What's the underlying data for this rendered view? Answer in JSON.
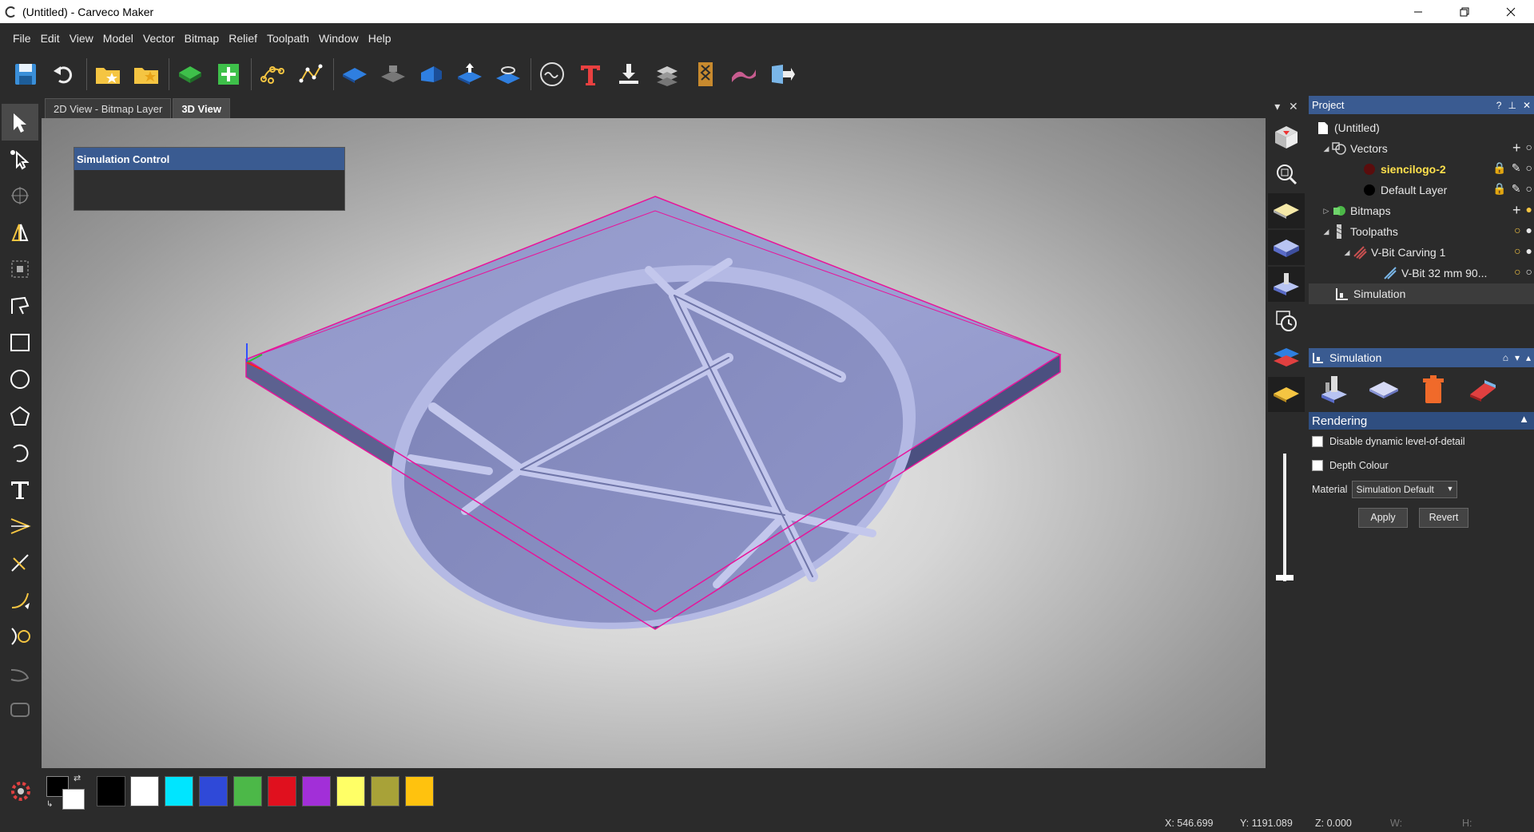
{
  "window": {
    "title": "(Untitled) - Carveco Maker"
  },
  "menu": [
    "File",
    "Edit",
    "View",
    "Model",
    "Vector",
    "Bitmap",
    "Relief",
    "Toolpath",
    "Window",
    "Help"
  ],
  "tabs": [
    {
      "label": "2D View - Bitmap Layer",
      "active": false
    },
    {
      "label": "3D View",
      "active": true
    }
  ],
  "simulation_control": {
    "title": "Simulation Control"
  },
  "project_panel": {
    "title": "Project",
    "tree": [
      {
        "label": "(Untitled)",
        "level": 0,
        "icon": "document-icon"
      },
      {
        "label": "Vectors",
        "level": 1,
        "icon": "vectors-icon",
        "expanded": true
      },
      {
        "label": "siencilogo-2",
        "level": 2,
        "icon": "layer-dark-red-icon",
        "highlight": true
      },
      {
        "label": "Default Layer",
        "level": 2,
        "icon": "layer-black-icon"
      },
      {
        "label": "Bitmaps",
        "level": 1,
        "icon": "bitmaps-icon",
        "expanded": false
      },
      {
        "label": "Toolpaths",
        "level": 1,
        "icon": "toolpaths-icon",
        "expanded": true
      },
      {
        "label": "V-Bit Carving 1",
        "level": 2,
        "icon": "vbit-carving-icon",
        "expanded": true
      },
      {
        "label": "V-Bit 32 mm 90...",
        "level": 3,
        "icon": "vbit-tool-icon"
      },
      {
        "label": "Simulation",
        "level": 1,
        "icon": "simulation-icon",
        "selected": true
      }
    ]
  },
  "simulation_panel": {
    "title": "Simulation",
    "section": "Rendering",
    "disable_lod_label": "Disable dynamic level-of-detail",
    "depth_colour_label": "Depth Colour",
    "material_label": "Material",
    "material_value": "Simulation Default",
    "apply_label": "Apply",
    "revert_label": "Revert"
  },
  "palette": [
    "#000000",
    "#ffffff",
    "#00e5ff",
    "#2f49d8",
    "#4cb848",
    "#e0101e",
    "#a22fd8",
    "#ffff66",
    "#a8a238",
    "#ffc20e"
  ],
  "status": {
    "x": "X: 546.699",
    "y": "Y: 1191.089",
    "z": "Z: 0.000",
    "w": "W:",
    "h": "H:"
  }
}
